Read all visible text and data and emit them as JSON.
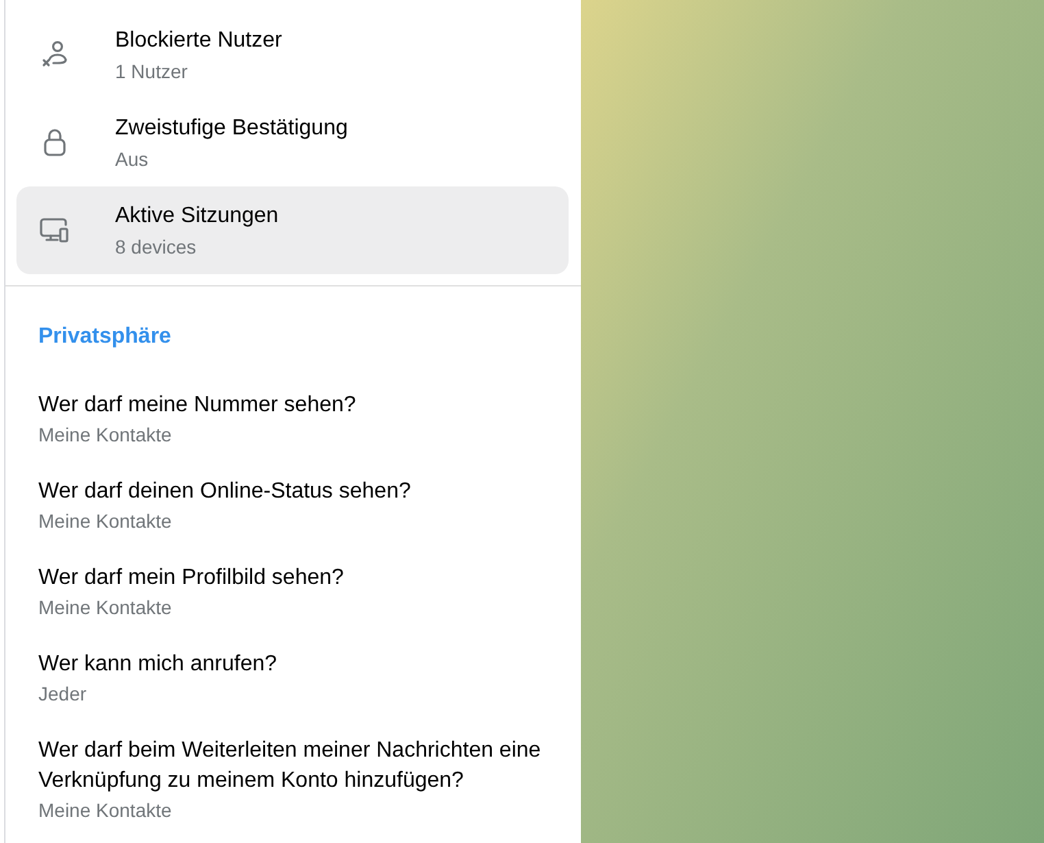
{
  "security_items": [
    {
      "kind": "blocked",
      "title": "Blockierte Nutzer",
      "subtitle": "1 Nutzer",
      "selected": false
    },
    {
      "kind": "lock",
      "title": "Zweistufige Bestätigung",
      "subtitle": "Aus",
      "selected": false
    },
    {
      "kind": "devices",
      "title": "Aktive Sitzungen",
      "subtitle": "8 devices",
      "selected": true
    }
  ],
  "privacy": {
    "heading": "Privatsphäre",
    "items": [
      {
        "title": "Wer darf meine Nummer sehen?",
        "subtitle": "Meine Kontakte"
      },
      {
        "title": "Wer darf deinen Online-Status sehen?",
        "subtitle": "Meine Kontakte"
      },
      {
        "title": "Wer darf mein Profilbild sehen?",
        "subtitle": "Meine Kontakte"
      },
      {
        "title": "Wer kann mich anrufen?",
        "subtitle": "Jeder"
      },
      {
        "title": "Wer darf beim Weiterleiten meiner Nachrichten eine Verknüpfung zu meinem Konto hinzufügen?",
        "subtitle": "Meine Kontakte"
      }
    ]
  }
}
